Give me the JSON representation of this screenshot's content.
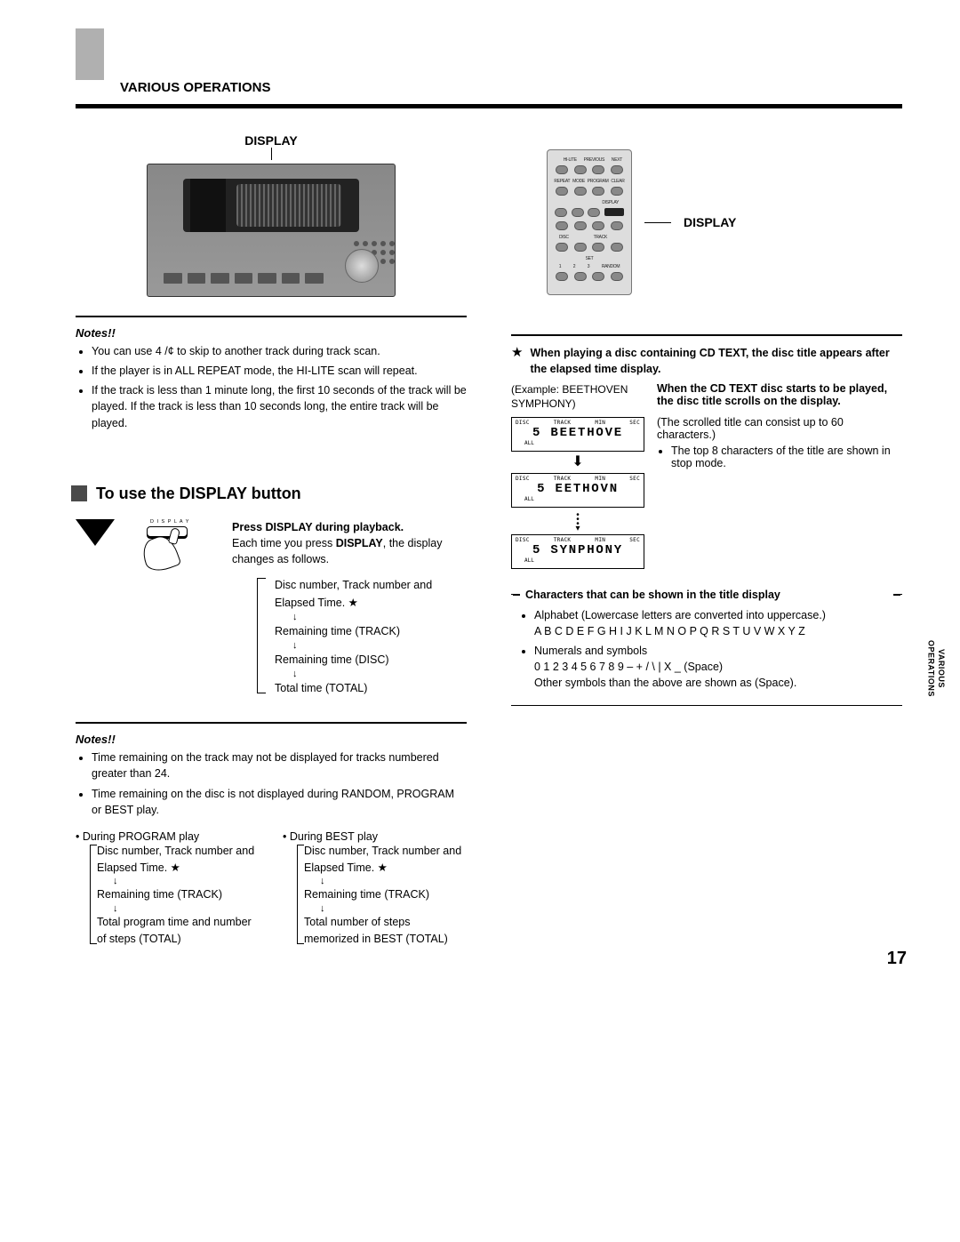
{
  "header": {
    "section_title": "VARIOUS OPERATIONS",
    "display_label_player": "DISPLAY",
    "display_label_remote": "DISPLAY"
  },
  "remote": {
    "row1_labels": [
      "HI-LITE",
      "PREVIOUS",
      "NEXT"
    ],
    "row2_labels": [
      "REPEAT",
      "MODE",
      "PROGRAM",
      "CLEAR"
    ],
    "display_key": "DISPLAY",
    "row4_labels": [
      "DISC",
      "TRACK"
    ],
    "row5_labels": [
      "1",
      "2",
      "3",
      "RANDOM"
    ],
    "set_label": "SET"
  },
  "notes1": {
    "title": "Notes!!",
    "items": [
      "You can use 4    /¢      to skip to another track during track scan.",
      "If the player is in ALL REPEAT mode, the HI-LITE scan will repeat.",
      "If the track is less than 1 minute long, the first 10 seconds of the track will be played. If the track is less than 10 seconds long, the entire track will be played."
    ]
  },
  "section2": {
    "title": "To use the DISPLAY button",
    "display_key_label": "D I S P L A Y",
    "step_heading": "Press DISPLAY during playback.",
    "step_text_prefix": "Each time you press ",
    "step_text_bold": "DISPLAY",
    "step_text_suffix": ", the display changes as follows.",
    "cycle": {
      "items": [
        "Disc number, Track number and Elapsed Time.  ★",
        "Remaining time (TRACK)",
        "Remaining time (DISC)",
        "Total time (TOTAL)"
      ]
    }
  },
  "notes2": {
    "title": "Notes!!",
    "items": [
      "Time remaining on the track may not be displayed for tracks numbered greater than 24.",
      "Time remaining on the disc is not displayed during RANDOM, PROGRAM or BEST play."
    ],
    "program_play_label": "During PROGRAM play",
    "program_play_cycle": [
      "Disc number, Track number and Elapsed Time.  ★",
      "Remaining time (TRACK)",
      "Total program time and number of steps (TOTAL)"
    ],
    "best_play_label": "During BEST play",
    "best_play_cycle": [
      "Disc number, Track number and Elapsed Time.  ★",
      "Remaining time (TRACK)",
      "Total number of steps memorized in BEST (TOTAL)"
    ]
  },
  "right": {
    "star_note": "When playing a disc containing CD TEXT, the disc title appears after the elapsed time display.",
    "example": "(Example: BEETHOVEN SYMPHONY)",
    "scroll_heading": "When the CD TEXT disc starts to be played, the disc title scrolls on the display.",
    "scroll_note": "(The scrolled title can consist up to 60 characters.)",
    "scroll_bullet": "The top 8 characters of the title are shown in stop mode.",
    "lcd_labels": {
      "disc": "DISC",
      "track": "TRACK",
      "min": "MIN",
      "sec": "SEC",
      "all": "ALL"
    },
    "lcd_values": [
      "5 BEETHOVE",
      "5 EETHOVN",
      "5 SYNPHONY"
    ],
    "char_box_title": "Characters that can be shown in the title display",
    "char_box_items": [
      "Alphabet (Lowercase letters are converted into uppercase.)\nA B C D E F G H I J K L M N O P Q R S T U V W X Y Z",
      "Numerals and symbols\n0 1 2 3 4 5 6 7 8 9 – + / \\ | X _  (Space)\nOther symbols than the above are shown as  (Space)."
    ]
  },
  "side_tab": "VARIOUS\nOPERATIONS",
  "page_number": "17"
}
